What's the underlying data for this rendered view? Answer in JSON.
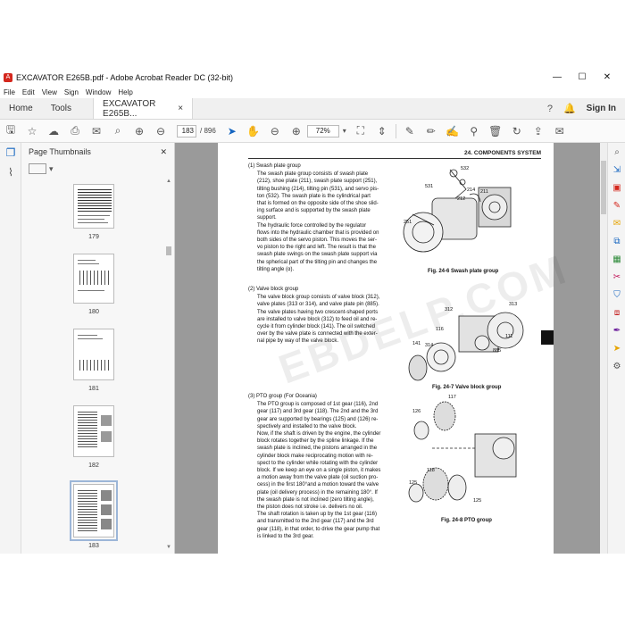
{
  "window": {
    "title": "EXCAVATOR E265B.pdf - Adobe Acrobat Reader DC (32-bit)",
    "app_icon": "A",
    "minimize": "—",
    "maximize": "☐",
    "close": "✕"
  },
  "menu": [
    "File",
    "Edit",
    "View",
    "Sign",
    "Window",
    "Help"
  ],
  "tabs": {
    "home": "Home",
    "tools": "Tools",
    "doc": "EXCAVATOR E265B...",
    "doc_close": "×",
    "signin": "Sign In"
  },
  "toolbar": {
    "page_current": "183",
    "page_total": "/ 896",
    "zoom": "72%"
  },
  "thumbnails": {
    "title": "Page Thumbnails",
    "close": "✕",
    "options_arrow": "▾",
    "pages": [
      "179",
      "180",
      "181",
      "182",
      "183"
    ]
  },
  "page": {
    "header": "24. COMPONENTS SYSTEM",
    "watermark": "EBDELP.COM",
    "sec1_heading": "(1)  Swash plate group",
    "sec1_lines": [
      "The swash plate group consists of swash plate",
      "(212), shoe plate (211), swash plate support (251),",
      "tilting bushing (214), tilting pin (531), and servo pis-",
      "ton (532). The swash plate is the cylindrical part",
      "that is formed on the opposite side of the shoe slid-",
      "ing surface and is supported by the swash plate",
      "support.",
      "The hydraulic force controlled by the regulator",
      "flows into the hydraulic chamber that is provided on",
      "both sides of the servo piston. This moves the ser-",
      "vo piston to the right and left. The result is that the",
      "swash plate swings on the swash plate support via",
      "the spherical part of the tilting pin and changes the",
      "tilting angle (α)."
    ],
    "sec2_heading": "(2)  Valve block group",
    "sec2_lines": [
      "The valve block group consists of valve block (312),",
      "valve plates (313 or 314), and valve plate pin (885).",
      "The valve plates having two crescent-shaped ports",
      "are installed to valve block (312) to feed oil and re-",
      "cycle it from cylinder block (141). The oil switched",
      "over by the valve plate is connected with the exter-",
      "nal pipe by way of the valve block."
    ],
    "sec3_heading": "(3)  PTO group (For Oceania)",
    "sec3_lines": [
      "The PTO group is composed of 1st gear (116), 2nd",
      "gear (117) and 3rd gear (118). The 2nd and the 3rd",
      "gear are supported by bearings (125) and (126) re-",
      "spectively and installed to the valve block.",
      "Now, if the shaft is driven by the engine, the cylinder",
      "block rotates together by the spline linkage. If the",
      "swash plate is inclined, the pistons arranged in the",
      "cylinder block make reciprocating motion with re-",
      "spect to the cylinder while rotating with the cylinder",
      "block. If we keep an eye on a single piston, it makes",
      "a motion away from the valve plate (oil suction pro-",
      "cess) in the first 180°and a motion toward the valve",
      "plate (oil delivery process) in the remaining 180°. If",
      "the swash plate is not inclined (zero tilting angle),",
      "the piston does not stroke i.e. delivers no oil.",
      "The shaft rotation is taken up by the 1st gear (116)",
      "and transmitted to the 2nd gear (117) and the 3rd",
      "gear (118), in that order, to drive the gear pump that",
      "is linked to the 3rd gear."
    ],
    "fig1_caption": "Fig. 24-6 Swash plate group",
    "fig2_caption": "Fig. 24-7 Valve block group",
    "fig3_caption": "Fig. 24-8 PTO group",
    "fig1_labels": [
      "532",
      "531",
      "214",
      "211",
      "212",
      "251"
    ],
    "fig2_labels": [
      "312",
      "313",
      "141",
      "314",
      "116",
      "111",
      "885"
    ],
    "fig3_labels": [
      "117",
      "126",
      "118",
      "125",
      "125"
    ]
  },
  "icons": {
    "left_rail": [
      "pages-icon",
      "attachment-icon"
    ],
    "right_rail": [
      "zoom-icon",
      "export-pdf-icon",
      "create-pdf-icon",
      "edit-pdf-icon",
      "comment-icon",
      "combine-icon",
      "organize-pages-icon",
      "redact-icon",
      "protect-icon",
      "compress-icon",
      "fill-sign-icon",
      "send-icon",
      "more-tools-icon"
    ]
  },
  "colors": {
    "accent": "#1565c0",
    "acrobat_red": "#d4271d"
  }
}
